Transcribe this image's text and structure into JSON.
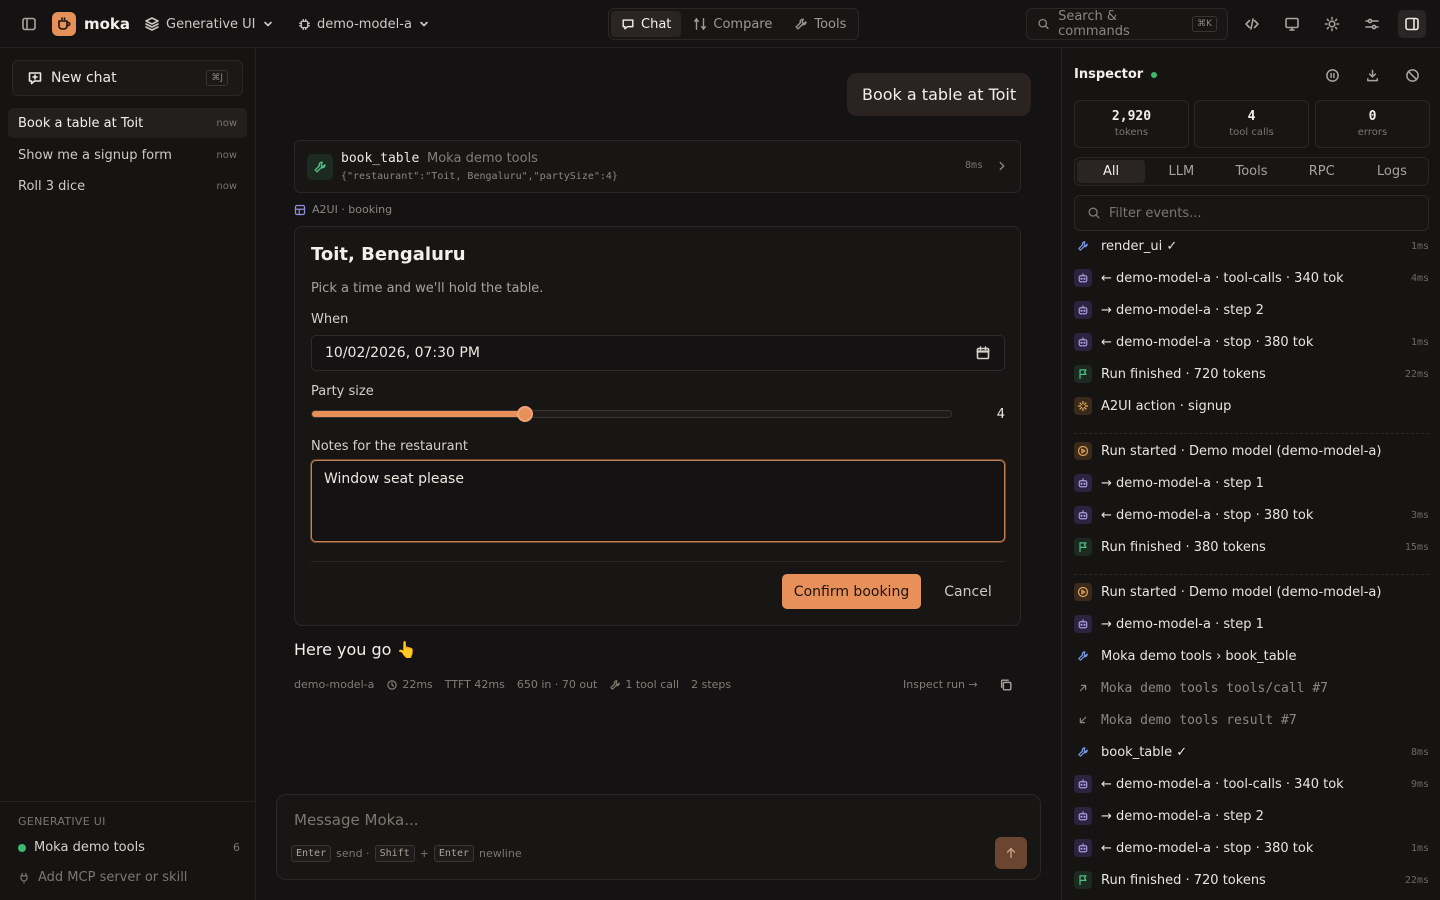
{
  "topbar": {
    "app_name": "moka",
    "workspace": "Generative UI",
    "model": "demo-model-a",
    "tabs": [
      {
        "label": "Chat",
        "active": true,
        "icon": "chat-bubble-icon"
      },
      {
        "label": "Compare",
        "active": false,
        "icon": "compare-icon"
      },
      {
        "label": "Tools",
        "active": false,
        "icon": "wrench-icon"
      }
    ],
    "search_placeholder": "Search & commands",
    "search_shortcut": "⌘K",
    "accent": "#e8905a"
  },
  "sidebar": {
    "new_chat_label": "New chat",
    "new_chat_shortcut": "⌘J",
    "chats": [
      {
        "title": "Book a table at Toit",
        "when": "now",
        "active": true
      },
      {
        "title": "Show me a signup form",
        "when": "now",
        "active": false
      },
      {
        "title": "Roll 3 dice",
        "when": "now",
        "active": false
      }
    ],
    "section_heading": "GENERATIVE UI",
    "server_name": "Moka demo tools",
    "server_count": "6",
    "server_status_color": "#3fb86f",
    "add_server_label": "Add MCP server or skill"
  },
  "conversation": {
    "user_message": "Book a table at Toit",
    "tool_call": {
      "name": "book_table",
      "source": "Moka demo tools",
      "args": "{\"restaurant\":\"Toit, Bengaluru\",\"partySize\":4}",
      "duration": "8ms"
    },
    "a2ui_label": "A2UI · booking",
    "booking": {
      "title": "Toit, Bengaluru",
      "subtitle": "Pick a time and we'll hold the table.",
      "when_label": "When",
      "when_value": "10/02/2026, 07:30 PM",
      "party_label": "Party size",
      "party_value": "4",
      "party_min": 1,
      "party_max": 10,
      "notes_label": "Notes for the restaurant",
      "notes_value": "Window seat please",
      "confirm_label": "Confirm booking",
      "cancel_label": "Cancel"
    },
    "assistant_text": "Here you go 👆",
    "meta": {
      "model": "demo-model-a",
      "latency": "22ms",
      "ttft": "TTFT 42ms",
      "tokens": "650 in · 70 out",
      "tool_calls": "1 tool call",
      "steps": "2 steps",
      "inspect_label": "Inspect run →"
    }
  },
  "composer": {
    "placeholder": "Message Moka...",
    "hint_enter": "Enter",
    "hint_send": "send ·",
    "hint_shift": "Shift",
    "hint_plus": "+",
    "hint_enter2": "Enter",
    "hint_newline": "newline"
  },
  "inspector": {
    "title": "Inspector",
    "stats": [
      {
        "value": "2,920",
        "label": "tokens"
      },
      {
        "value": "4",
        "label": "tool calls"
      },
      {
        "value": "0",
        "label": "errors"
      }
    ],
    "filters": [
      {
        "label": "All",
        "active": true
      },
      {
        "label": "LLM",
        "active": false
      },
      {
        "label": "Tools",
        "active": false
      },
      {
        "label": "RPC",
        "active": false
      },
      {
        "label": "Logs",
        "active": false
      }
    ],
    "filter_placeholder": "Filter events...",
    "events": [
      {
        "kind": "tool",
        "text": "render_ui ✓",
        "dur": "1ms"
      },
      {
        "kind": "llm",
        "text": "← demo-model-a · tool-calls · 340 tok",
        "dur": "4ms"
      },
      {
        "kind": "llm",
        "text": "→ demo-model-a · step 2",
        "dur": ""
      },
      {
        "kind": "llm",
        "text": "← demo-model-a · stop · 380 tok",
        "dur": "1ms"
      },
      {
        "kind": "ok",
        "text": "Run finished · 720 tokens",
        "dur": "22ms"
      },
      {
        "kind": "act",
        "text": "A2UI action · signup",
        "dur": ""
      },
      {
        "kind": "sep"
      },
      {
        "kind": "run",
        "text": "Run started · Demo model (demo-model-a)",
        "dur": ""
      },
      {
        "kind": "llm",
        "text": "→ demo-model-a · step 1",
        "dur": ""
      },
      {
        "kind": "llm",
        "text": "← demo-model-a · stop · 380 tok",
        "dur": "3ms"
      },
      {
        "kind": "ok",
        "text": "Run finished · 380 tokens",
        "dur": "15ms"
      },
      {
        "kind": "sep"
      },
      {
        "kind": "run",
        "text": "Run started · Demo model (demo-model-a)",
        "dur": ""
      },
      {
        "kind": "llm",
        "text": "→ demo-model-a · step 1",
        "dur": ""
      },
      {
        "kind": "tool",
        "text": "Moka demo tools › book_table",
        "dur": ""
      },
      {
        "kind": "rpc-out",
        "text": "Moka demo tools tools/call #7",
        "dur": ""
      },
      {
        "kind": "rpc-in",
        "text": "Moka demo tools result #7",
        "dur": ""
      },
      {
        "kind": "tool",
        "text": "book_table ✓",
        "dur": "8ms"
      },
      {
        "kind": "llm",
        "text": "← demo-model-a · tool-calls · 340 tok",
        "dur": "9ms"
      },
      {
        "kind": "llm",
        "text": "→ demo-model-a · step 2",
        "dur": ""
      },
      {
        "kind": "llm",
        "text": "← demo-model-a · stop · 380 tok",
        "dur": "1ms"
      },
      {
        "kind": "ok",
        "text": "Run finished · 720 tokens",
        "dur": "22ms"
      }
    ]
  }
}
